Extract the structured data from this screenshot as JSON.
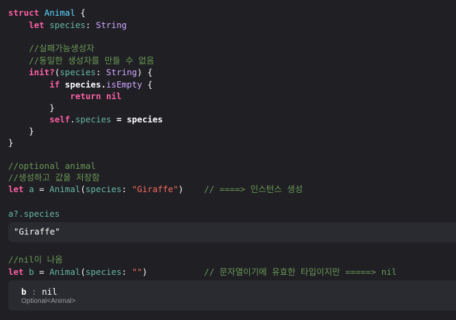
{
  "code": {
    "line1_kw": "struct",
    "line1_name": "Animal",
    "line1_brace": " {",
    "line2_kw": "let",
    "line2_prop": "species",
    "line2_colon": ": ",
    "line2_type": "String",
    "comment1": "//실패가능생성자",
    "comment2": "//동일한 생성자를 만들 수 없음",
    "init_kw": "init?",
    "init_open": "(",
    "init_param": "species",
    "init_colon": ": ",
    "init_type": "String",
    "init_close": ") {",
    "if_kw": "if",
    "if_obj": " species.",
    "if_prop": "isEmpty",
    "if_brace": " {",
    "return_kw": "return",
    "return_val": " nil",
    "close1": "}",
    "self_kw": "self",
    "self_dot": ".",
    "self_prop": "species",
    "self_rest": " = species",
    "close2": "}",
    "close3": "}",
    "comment3": "//optional animal",
    "comment4": "//생성하고 값을 저장함",
    "leta_kw": "let",
    "leta_var": "a",
    "leta_eq": " = ",
    "leta_type": "Animal",
    "leta_open": "(",
    "leta_param": "species",
    "leta_colon": ": ",
    "leta_str": "\"Giraffe\"",
    "leta_close": ")",
    "leta_comment": "// ====> 인스턴스 생성",
    "access_var": "a?.",
    "access_prop": "species",
    "comment5": "//nil이 나옴",
    "letb_kw": "let",
    "letb_var": "b",
    "letb_eq": " = ",
    "letb_type": "Animal",
    "letb_open": "(",
    "letb_param": "species",
    "letb_colon": ": ",
    "letb_str": "\"\"",
    "letb_close": ")",
    "letb_comment": "// 문자열이기에 유효한 타입이지만 =====> nil"
  },
  "results": {
    "result1_value": "\"Giraffe\"",
    "result2_name": "b",
    "result2_colon": " : ",
    "result2_value": "nil",
    "result2_type": "Optional<Animal>"
  },
  "colors": {
    "background": "#1f1f24",
    "keyword": "#fc5fa3",
    "type": "#d0a8ff",
    "declared_type": "#5dd8ff",
    "property": "#67b7a4",
    "string": "#fc6a5d",
    "comment": "#6c9a56",
    "result_box": "#2a2b30"
  }
}
